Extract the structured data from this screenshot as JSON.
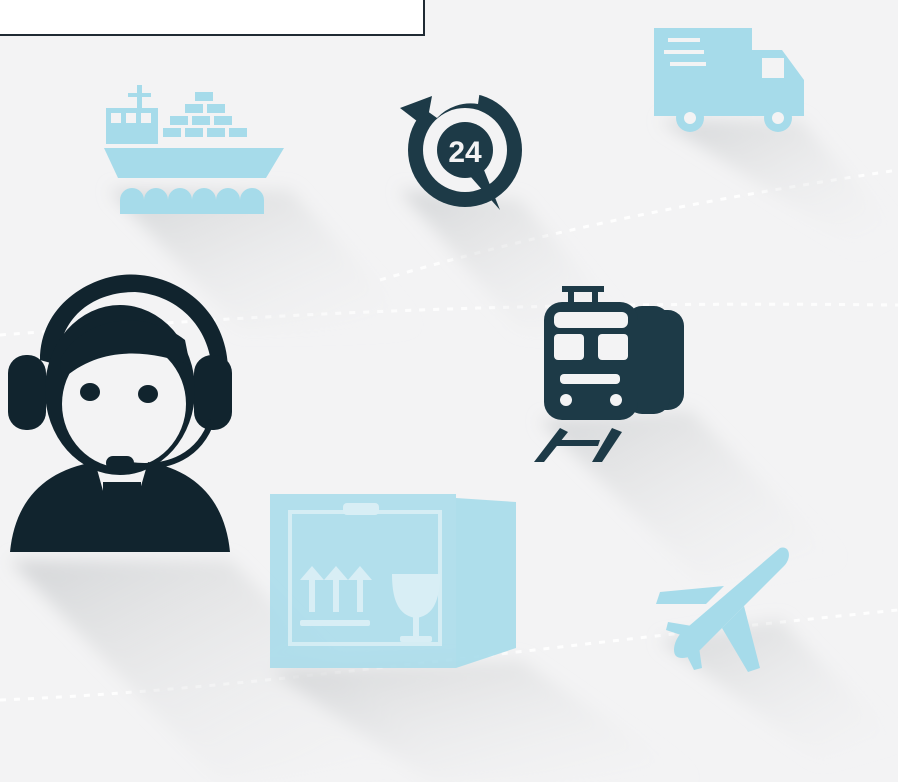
{
  "icons": {
    "clock_badge": "24",
    "ship": "cargo-ship-icon",
    "clock": "24-hour-service-icon",
    "truck": "delivery-truck-icon",
    "agent": "customer-service-agent-icon",
    "train": "train-icon",
    "box": "fragile-package-icon",
    "plane": "airplane-icon"
  },
  "colors": {
    "light_blue": "#a6dbea",
    "dark_navy": "#1d3a47",
    "background": "#f3f3f4"
  }
}
